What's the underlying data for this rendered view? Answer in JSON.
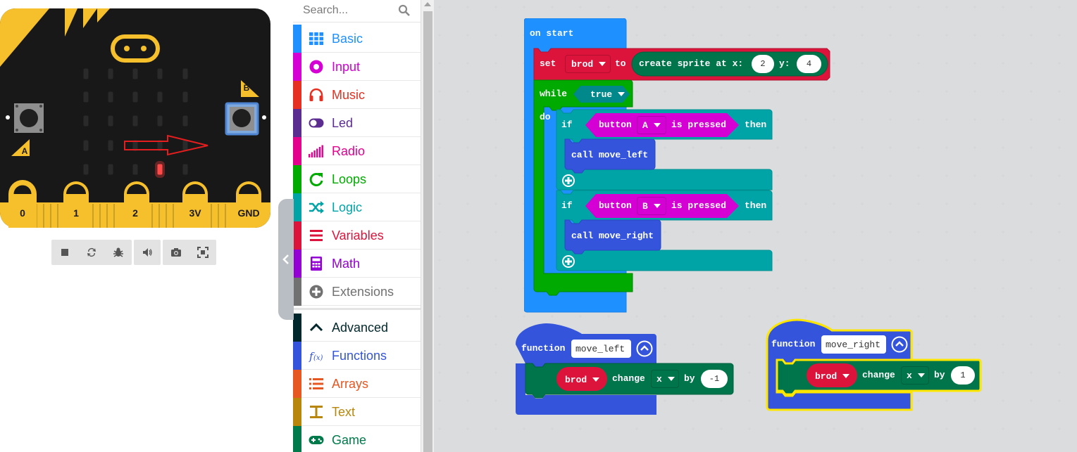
{
  "simulator": {
    "pin_labels": [
      "0",
      "1",
      "2",
      "3V",
      "GND"
    ],
    "button_a_label": "A",
    "button_b_label": "B",
    "led_lit": {
      "row": 4,
      "col": 3
    }
  },
  "sim_toolbar": {
    "buttons": [
      "stop-icon",
      "restart-icon",
      "debug-icon",
      "sound-icon",
      "screenshot-icon",
      "fullscreen-icon"
    ]
  },
  "toolbox": {
    "search_placeholder": "Search...",
    "categories": [
      {
        "label": "Basic",
        "color": "#1E90FF",
        "icon": "grid-icon"
      },
      {
        "label": "Input",
        "color": "#D400D4",
        "icon": "target-icon"
      },
      {
        "label": "Music",
        "color": "#E63022",
        "icon": "headphones-icon"
      },
      {
        "label": "Led",
        "color": "#5C2D91",
        "icon": "toggle-icon"
      },
      {
        "label": "Radio",
        "color": "#E3008C",
        "icon": "signal-bars-icon"
      },
      {
        "label": "Loops",
        "color": "#00AA00",
        "icon": "loop-arrow-icon"
      },
      {
        "label": "Logic",
        "color": "#00A4A6",
        "icon": "shuffle-icon"
      },
      {
        "label": "Variables",
        "color": "#DC143C",
        "icon": "list-lines-icon"
      },
      {
        "label": "Math",
        "color": "#9400D3",
        "icon": "calculator-icon"
      },
      {
        "label": "Extensions",
        "color": "#717171",
        "icon": "plus-circle-icon"
      },
      {
        "label": "Advanced",
        "color": "#00272B",
        "icon": "chevron-up-icon"
      },
      {
        "label": "Functions",
        "color": "#3455DB",
        "icon": "function-icon"
      },
      {
        "label": "Arrays",
        "color": "#E65722",
        "icon": "list-icon"
      },
      {
        "label": "Text",
        "color": "#B8860B",
        "icon": "text-icon"
      },
      {
        "label": "Game",
        "color": "#007A4B",
        "icon": "gamepad-icon"
      }
    ]
  },
  "workspace": {
    "on_start": {
      "header": "on start",
      "set": {
        "keyword": "set",
        "variable": "brod",
        "to": "to",
        "call": "create sprite at x:",
        "x": "2",
        "y_label": "y:",
        "y": "4"
      },
      "while": {
        "keyword": "while",
        "condition": "true",
        "do": "do"
      },
      "if_a": {
        "keyword": "if",
        "button_text": "button",
        "button": "A",
        "pressed": "is pressed",
        "then": "then",
        "call": "call move_left"
      },
      "if_b": {
        "keyword": "if",
        "button_text": "button",
        "button": "B",
        "pressed": "is pressed",
        "then": "then",
        "call": "call move_right"
      }
    },
    "function_left": {
      "keyword": "function",
      "name": "move_left",
      "variable": "brod",
      "change": "change",
      "axis": "x",
      "by": "by",
      "amount": "-1"
    },
    "function_right": {
      "keyword": "function",
      "name": "move_right",
      "variable": "brod",
      "change": "change",
      "axis": "x",
      "by": "by",
      "amount": "1"
    }
  }
}
